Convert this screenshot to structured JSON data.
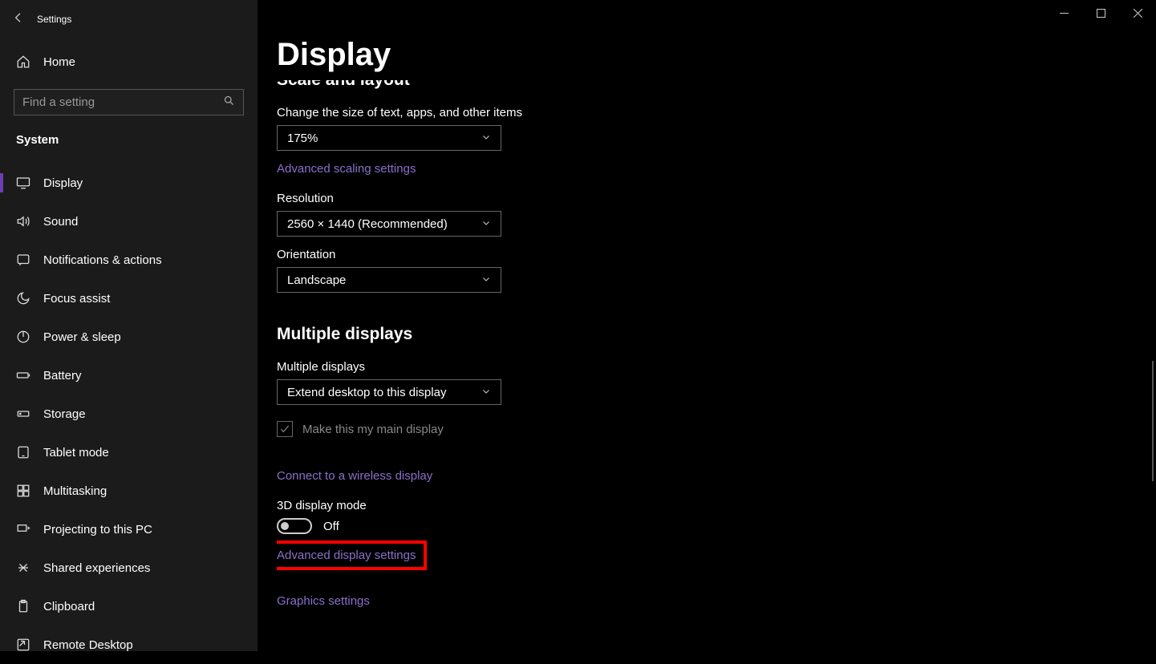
{
  "window": {
    "title": "Settings"
  },
  "sidebar": {
    "home_label": "Home",
    "search_placeholder": "Find a setting",
    "category": "System",
    "items": [
      {
        "label": "Display",
        "icon": "monitor",
        "active": true
      },
      {
        "label": "Sound",
        "icon": "sound",
        "active": false
      },
      {
        "label": "Notifications & actions",
        "icon": "notifications",
        "active": false
      },
      {
        "label": "Focus assist",
        "icon": "moon",
        "active": false
      },
      {
        "label": "Power & sleep",
        "icon": "power",
        "active": false
      },
      {
        "label": "Battery",
        "icon": "battery",
        "active": false
      },
      {
        "label": "Storage",
        "icon": "storage",
        "active": false
      },
      {
        "label": "Tablet mode",
        "icon": "tablet",
        "active": false
      },
      {
        "label": "Multitasking",
        "icon": "multitask",
        "active": false
      },
      {
        "label": "Projecting to this PC",
        "icon": "project",
        "active": false
      },
      {
        "label": "Shared experiences",
        "icon": "shared",
        "active": false
      },
      {
        "label": "Clipboard",
        "icon": "clipboard",
        "active": false
      },
      {
        "label": "Remote Desktop",
        "icon": "remote",
        "active": false
      }
    ]
  },
  "page": {
    "heading": "Display",
    "section1_title": "Scale and layout",
    "scale_label": "Change the size of text, apps, and other items",
    "scale_value": "175%",
    "advanced_scaling_link": "Advanced scaling settings",
    "resolution_label": "Resolution",
    "resolution_value": "2560 × 1440 (Recommended)",
    "orientation_label": "Orientation",
    "orientation_value": "Landscape",
    "section2_title": "Multiple displays",
    "multi_label": "Multiple displays",
    "multi_value": "Extend desktop to this display",
    "main_display_checkbox_label": "Make this my main display",
    "connect_wireless_link": "Connect to a wireless display",
    "mode_3d_label": "3D display mode",
    "mode_3d_value": "Off",
    "advanced_display_link": "Advanced display settings",
    "graphics_link": "Graphics settings"
  }
}
